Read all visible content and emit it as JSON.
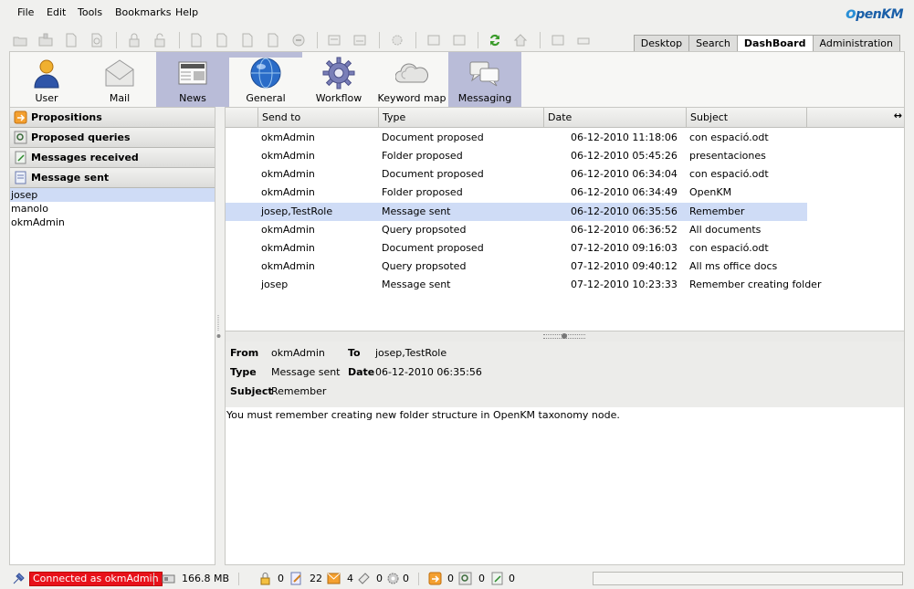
{
  "menu": [
    "File",
    "Edit",
    "Tools",
    "Bookmarks",
    "Help"
  ],
  "logo": {
    "o": "o",
    "rest": "penKM"
  },
  "top_tabs": [
    {
      "label": "Desktop",
      "active": false
    },
    {
      "label": "Search",
      "active": false
    },
    {
      "label": "DashBoard",
      "active": true
    },
    {
      "label": "Administration",
      "active": false
    }
  ],
  "dashboard_icons": [
    {
      "label": "User",
      "icon": "user-icon",
      "selected": false
    },
    {
      "label": "Mail",
      "icon": "mail-icon",
      "selected": false
    },
    {
      "label": "News",
      "icon": "news-icon",
      "selected": true
    },
    {
      "label": "General",
      "icon": "globe-icon",
      "selected": false
    },
    {
      "label": "Workflow",
      "icon": "workflow-gear-icon",
      "selected": false
    },
    {
      "label": "Keyword map",
      "icon": "keyword-map-icon",
      "selected": false
    },
    {
      "label": "Messaging",
      "icon": "messaging-icon",
      "selected": true
    }
  ],
  "left_stack": {
    "headers": [
      "Propositions",
      "Proposed queries",
      "Messages received",
      "Message sent"
    ],
    "users": [
      "josep",
      "manolo",
      "okmAdmin"
    ],
    "selected_user": "josep"
  },
  "table": {
    "columns": [
      "Send to",
      "Type",
      "Date",
      "Subject"
    ],
    "rows": [
      {
        "send_to": "okmAdmin",
        "type": "Document proposed",
        "date": "06-12-2010 11:18:06",
        "subject": "con espació.odt"
      },
      {
        "send_to": "okmAdmin",
        "type": "Folder proposed",
        "date": "06-12-2010 05:45:26",
        "subject": "presentaciones"
      },
      {
        "send_to": "okmAdmin",
        "type": "Document proposed",
        "date": "06-12-2010 06:34:04",
        "subject": "con espació.odt"
      },
      {
        "send_to": "okmAdmin",
        "type": "Folder proposed",
        "date": "06-12-2010 06:34:49",
        "subject": "OpenKM"
      },
      {
        "send_to": "josep,TestRole",
        "type": "Message sent",
        "date": "06-12-2010 06:35:56",
        "subject": "Remember",
        "selected": true
      },
      {
        "send_to": "okmAdmin",
        "type": "Query propsoted",
        "date": "06-12-2010 06:36:52",
        "subject": "All documents"
      },
      {
        "send_to": "okmAdmin",
        "type": "Document proposed",
        "date": "07-12-2010 09:16:03",
        "subject": "con espació.odt"
      },
      {
        "send_to": "okmAdmin",
        "type": "Query propsoted",
        "date": "07-12-2010 09:40:12",
        "subject": "All ms office docs"
      },
      {
        "send_to": "josep",
        "type": "Message sent",
        "date": "07-12-2010 10:23:33",
        "subject": "Remember creating folder"
      }
    ]
  },
  "details": {
    "from_label": "From",
    "from": "okmAdmin",
    "to_label": "To",
    "to": "josep,TestRole",
    "type_label": "Type",
    "type": "Message sent",
    "date_label": "Date",
    "date": "06-12-2010 06:35:56",
    "subject_label": "Subject",
    "subject": "Remember",
    "body": "You must remember creating new folder structure in OpenKM taxonomy node."
  },
  "status": {
    "connected": "Connected as okmAdmin",
    "size": "166.8 MB",
    "locked": "0",
    "checkout": "22",
    "subscribed": "4",
    "news_docs": "0",
    "workflow": "0",
    "propositions": "0",
    "queries": "0",
    "messages": "0"
  },
  "colors": {
    "selection": "#cfdcf6",
    "dash_selected": "#b9bcd8",
    "connected_bg": "#e8111a"
  }
}
